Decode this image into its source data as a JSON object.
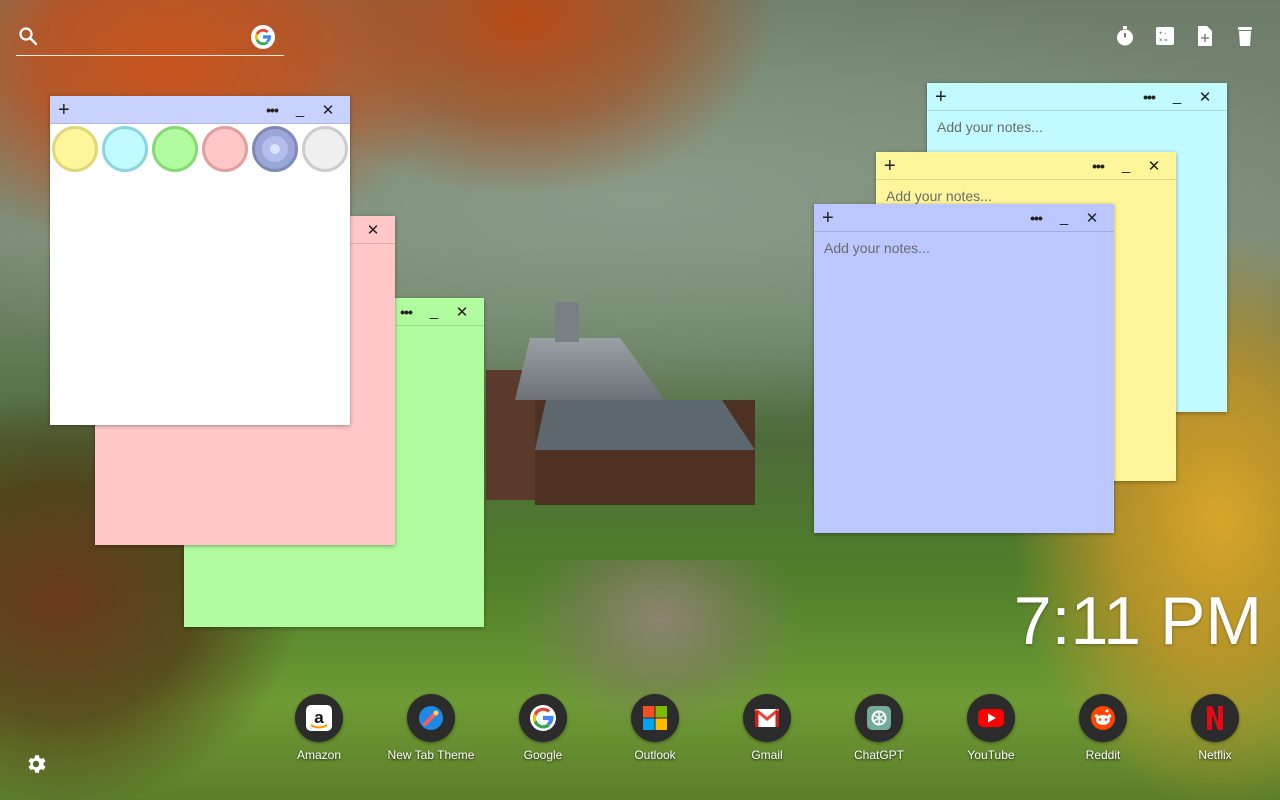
{
  "search": {
    "placeholder": ""
  },
  "top_tools": [
    {
      "icon": "stopwatch-icon"
    },
    {
      "icon": "calculator-icon"
    },
    {
      "icon": "new-note-icon"
    },
    {
      "icon": "trash-icon"
    }
  ],
  "notes": {
    "placeholder": "Add your notes...",
    "colors": {
      "white": "#ffffff",
      "pink": "#ffc7c7",
      "green": "#b1fc9e",
      "blue": "#c1fbff",
      "yellow": "#fff59b",
      "purple": "#bcc7ff"
    }
  },
  "palette": [
    {
      "name": "yellow",
      "fill": "#fff59b",
      "ring": "#e1d77a"
    },
    {
      "name": "cyan",
      "fill": "#c1fbff",
      "ring": "#8ad6e0"
    },
    {
      "name": "green",
      "fill": "#b1fc9e",
      "ring": "#86d974"
    },
    {
      "name": "pink",
      "fill": "#ffc7c7",
      "ring": "#e0a0a0"
    },
    {
      "name": "purple",
      "fill": "#9ba7d8",
      "ring": "#7f89b8",
      "selected": true
    },
    {
      "name": "gray",
      "fill": "#efefef",
      "ring": "#cccccc"
    }
  ],
  "clock": {
    "time": "7:11 PM"
  },
  "dock": [
    {
      "label": "Amazon",
      "icon": "amazon-icon"
    },
    {
      "label": "New Tab Theme",
      "icon": "new-tab-theme-icon"
    },
    {
      "label": "Google",
      "icon": "google-icon"
    },
    {
      "label": "Outlook",
      "icon": "outlook-icon"
    },
    {
      "label": "Gmail",
      "icon": "gmail-icon"
    },
    {
      "label": "ChatGPT",
      "icon": "chatgpt-icon"
    },
    {
      "label": "YouTube",
      "icon": "youtube-icon"
    },
    {
      "label": "Reddit",
      "icon": "reddit-icon"
    },
    {
      "label": "Netflix",
      "icon": "netflix-icon"
    }
  ]
}
